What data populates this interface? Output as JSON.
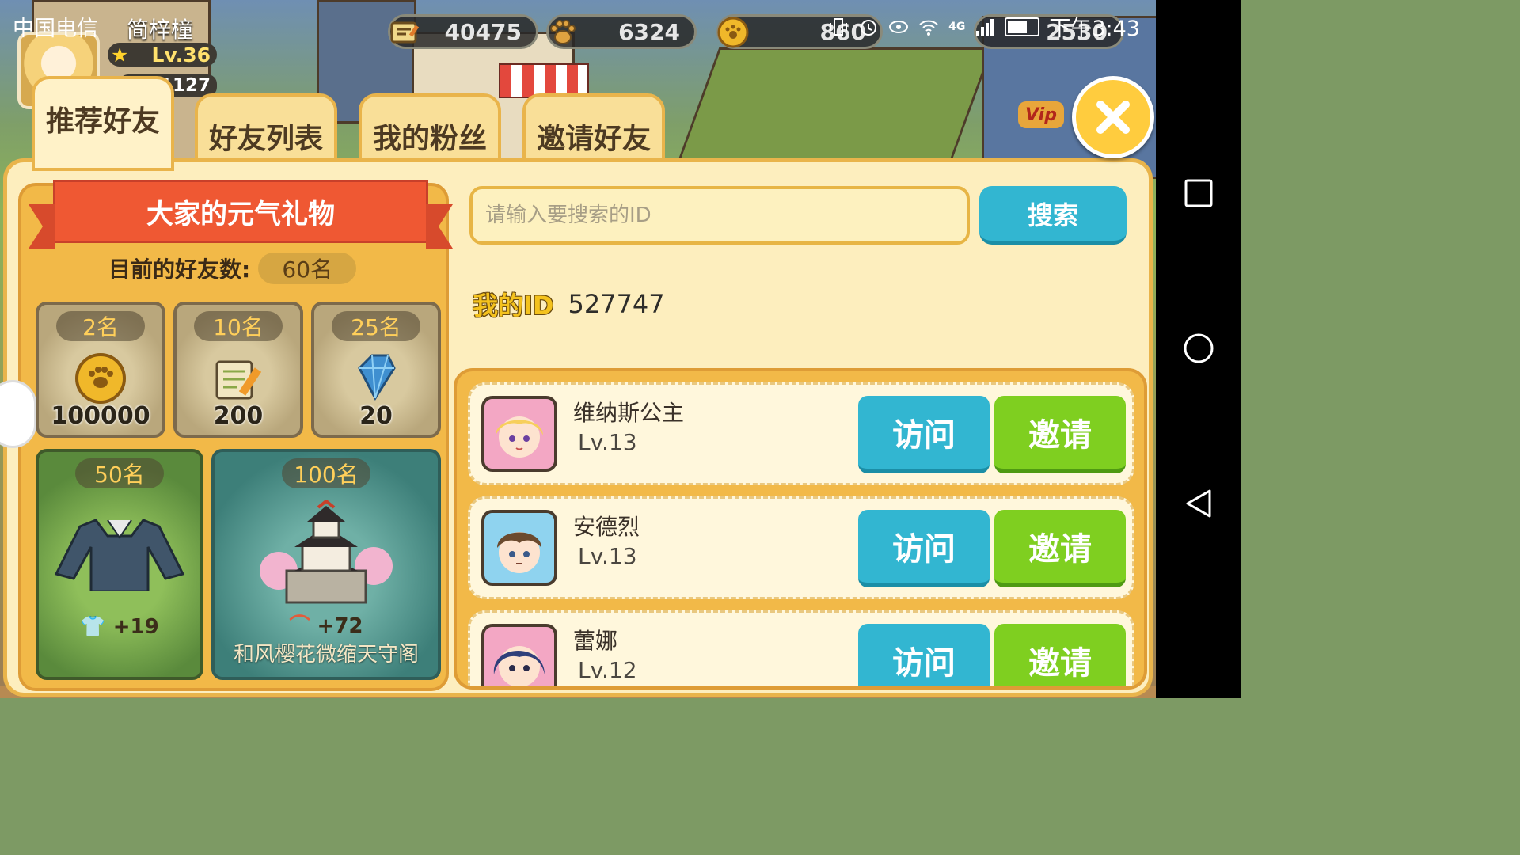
{
  "status_bar": {
    "carrier": "中国电信",
    "time": "下午3:43",
    "network": "4G"
  },
  "player": {
    "name": "简梓橦",
    "level": "Lv.36",
    "exp": "1127"
  },
  "resources": [
    {
      "icon": "ticket-icon",
      "value": "40475"
    },
    {
      "icon": "paw-icon",
      "value": "6324"
    },
    {
      "icon": "coin-icon",
      "value": "860"
    },
    {
      "icon": "unknown",
      "value": "2530"
    }
  ],
  "tabs": [
    {
      "label": "推荐好友",
      "active": true
    },
    {
      "label": "好友列表",
      "active": false
    },
    {
      "label": "我的粉丝",
      "active": false
    },
    {
      "label": "邀请好友",
      "active": false
    }
  ],
  "vip_label": "Vip",
  "gift_panel": {
    "title": "大家的元气礼物",
    "friend_count_label": "目前的好友数:",
    "friend_count": "60名",
    "rewards": [
      {
        "tier": "2名",
        "amount": "100000",
        "icon": "paw-coin-icon"
      },
      {
        "tier": "10名",
        "amount": "200",
        "icon": "notebook-pencil-icon"
      },
      {
        "tier": "25名",
        "amount": "20",
        "icon": "diamond-icon"
      },
      {
        "tier": "50名",
        "bonus": "+19",
        "icon": "jacket-icon"
      },
      {
        "tier": "100名",
        "bonus": "+72",
        "caption": "和风樱花微缩天守阁",
        "icon": "castle-icon"
      }
    ]
  },
  "search": {
    "placeholder": "请输入要搜索的ID",
    "button_label": "搜索"
  },
  "my_id": {
    "label": "我的ID",
    "value": "527747"
  },
  "friends": [
    {
      "name": "维纳斯公主",
      "level": "Lv.13",
      "visit": "访问",
      "invite": "邀请"
    },
    {
      "name": "安德烈",
      "level": "Lv.13",
      "visit": "访问",
      "invite": "邀请"
    },
    {
      "name": "蕾娜",
      "level": "Lv.12",
      "visit": "访问",
      "invite": "邀请"
    }
  ],
  "colors": {
    "panel_bg": "#fdeebe",
    "gift_panel_bg": "#f2b948",
    "ribbon": "#ef5833",
    "visit_button": "#32b6d1",
    "invite_button": "#7fcf20",
    "close_button": "#ffcc3e"
  }
}
